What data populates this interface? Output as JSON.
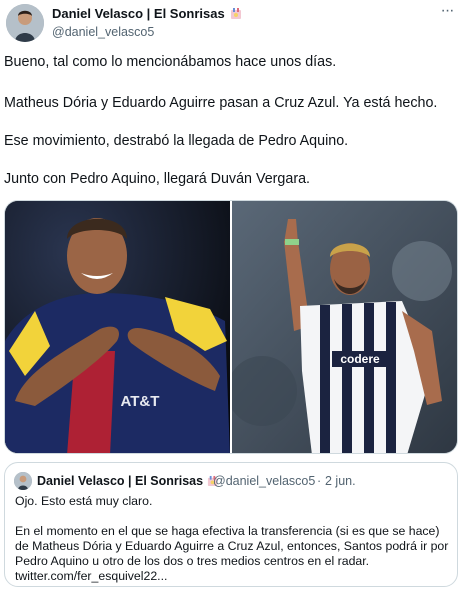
{
  "author": {
    "name": "Daniel Velasco | El Sonrisas",
    "handle": "@daniel_velasco5"
  },
  "more_icon": "···",
  "tweet": {
    "lines": [
      "Bueno, tal como lo mencionábamos hace unos días.",
      "Matheus Dória y Eduardo Aguirre pasan a Cruz Azul. Ya está hecho.",
      "Ese movimiento, destrabó la llegada de Pedro Aquino.",
      "Junto con Pedro Aquino, llegará Duván Vergara."
    ]
  },
  "media": {
    "left_jersey_text": "AT&T",
    "right_jersey_text": "codere"
  },
  "quoted_tweet": {
    "name": "Daniel Velasco | El Sonrisas",
    "handle": "@daniel_velasco5",
    "separator": "·",
    "date": "2 jun.",
    "lines": [
      "Ojo. Esto está muy claro.",
      "",
      "En el momento en el que se haga efectiva la transferencia (si es que se hace)",
      "de Matheus Dória y Eduardo Aguirre a Cruz Azul, entonces, Santos podrá ir por",
      "Pedro Aquino u otro de los dos o tres medios centros en el radar.",
      "twitter.com/fer_esquivel22..."
    ]
  },
  "colors": {
    "text": "#0f1419",
    "secondary": "#536471",
    "border": "#cfd9de",
    "america_yellow": "#f2d33a",
    "america_navy": "#1c2a63",
    "monterrey_navy": "#1b2340"
  },
  "icons": [
    "avatar",
    "emoji-icon",
    "more-icon"
  ]
}
